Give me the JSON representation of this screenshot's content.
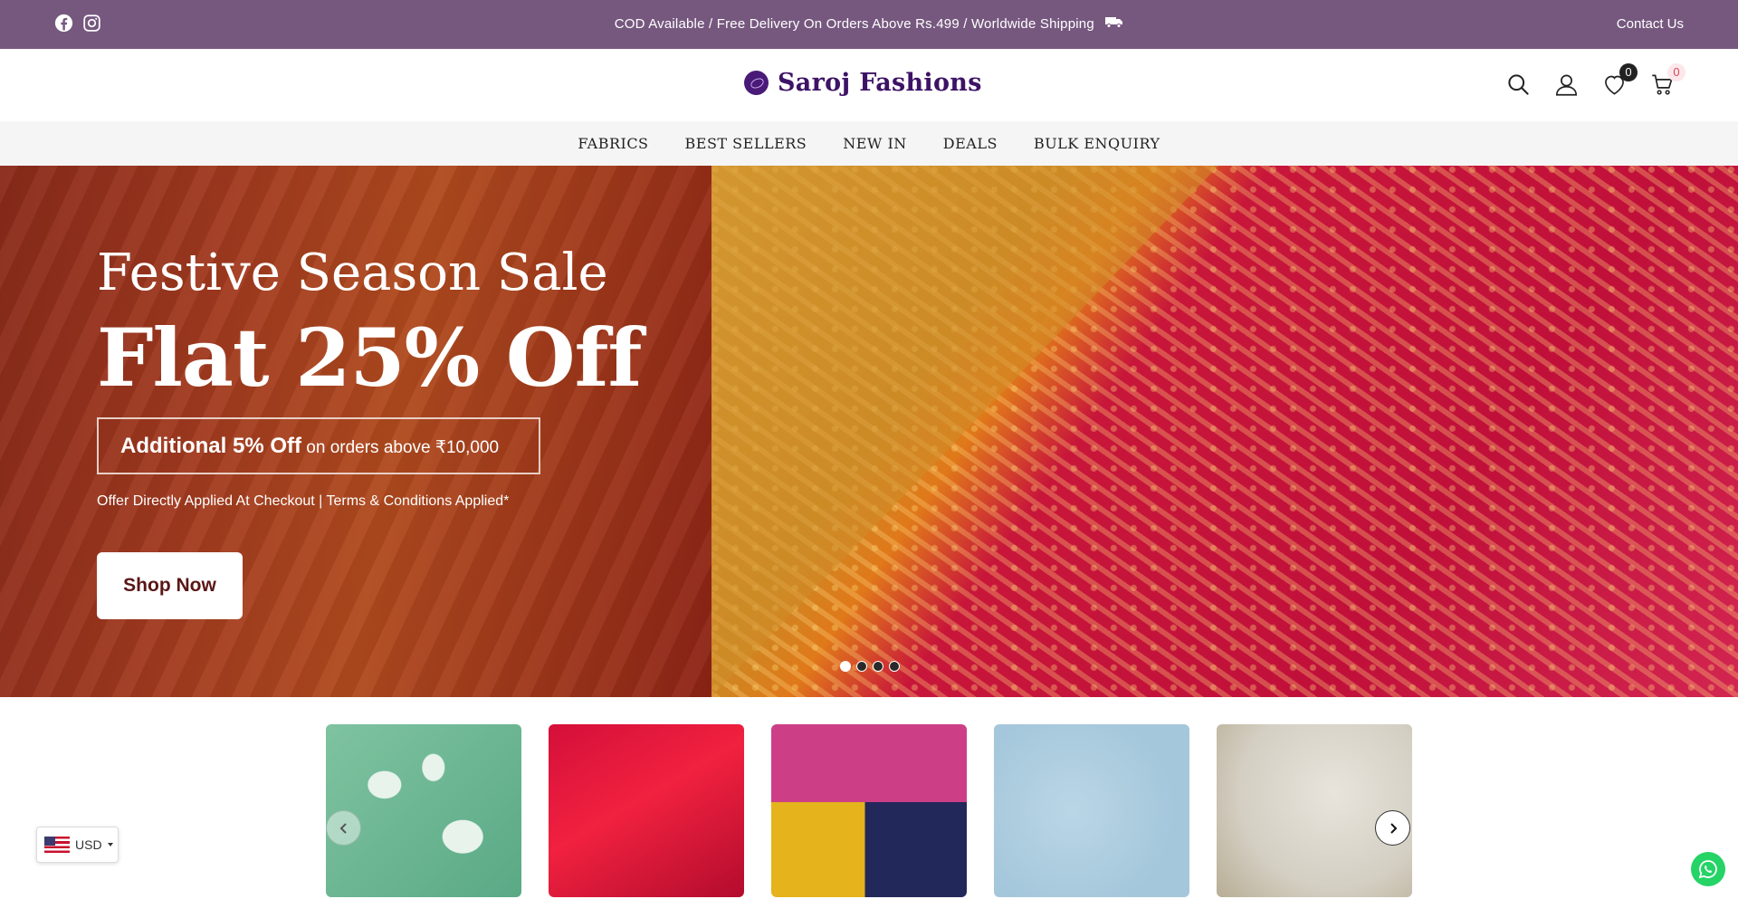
{
  "announcement": {
    "message": "COD Available / Free Delivery On Orders Above Rs.499 / Worldwide Shipping",
    "contact_label": "Contact Us",
    "background_color": "#76587f"
  },
  "header": {
    "brand_name": "Saroj Fashions",
    "wishlist_count": "0",
    "cart_count": "0"
  },
  "nav": {
    "items": [
      "FABRICS",
      "BEST SELLERS",
      "NEW IN",
      "DEALS",
      "BULK ENQUIRY"
    ]
  },
  "hero": {
    "headline": "Festive Season Sale",
    "offer": "Flat 25% Off",
    "additional_bold": "Additional 5% Off",
    "additional_rest": " on orders above ₹10,000",
    "terms": "Offer Directly Applied At Checkout | Terms & Conditions Applied*",
    "cta_label": "Shop Now",
    "slide_count": 4,
    "active_slide": 1
  },
  "currency": {
    "code": "USD"
  },
  "icons": {
    "social": [
      "facebook-icon",
      "instagram-icon"
    ],
    "header": [
      "search-icon",
      "account-icon",
      "wishlist-heart-icon",
      "cart-icon"
    ]
  }
}
